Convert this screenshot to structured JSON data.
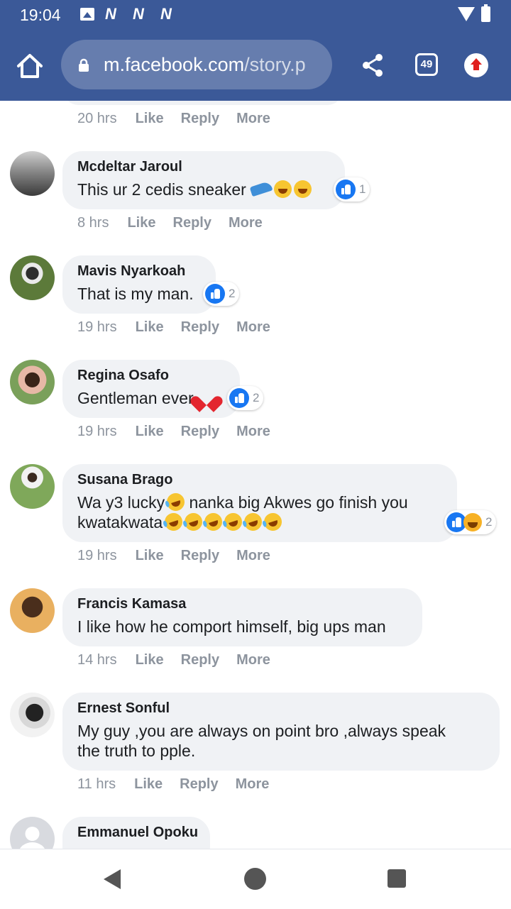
{
  "status_bar": {
    "time": "19:04",
    "notification_icons": [
      "N",
      "N",
      "N"
    ]
  },
  "browser": {
    "url_host": "m.facebook.com",
    "url_path": "/story.p",
    "tab_count": "49"
  },
  "actions": {
    "like": "Like",
    "reply": "Reply",
    "more": "More"
  },
  "top_partial": {
    "time": "20 hrs"
  },
  "comments": [
    {
      "author": "Mcdeltar Jaroul",
      "text": "This ur 2 cedis sneaker",
      "time": "8 hrs",
      "reactions": "1"
    },
    {
      "author": "Mavis Nyarkoah",
      "text": "That is my man.",
      "time": "19 hrs",
      "reactions": "2"
    },
    {
      "author": "Regina Osafo",
      "text": "Gentleman ever",
      "time": "19 hrs",
      "reactions": "2"
    },
    {
      "author": "Susana Brago",
      "text_line1": "Wa y3 lucky",
      "text_line1b": " nanka big Akwes go finish you",
      "text_line2": "kwatakwata",
      "time": "19 hrs",
      "reactions": "2"
    },
    {
      "author": "Francis Kamasa",
      "text": "I like how he comport himself, big ups man",
      "time": "14 hrs"
    },
    {
      "author": "Ernest Sonful",
      "text_line1": "My guy ,you are always on point bro ,always speak",
      "text_line2": "the truth to pple.",
      "time": "11 hrs"
    },
    {
      "author": "Emmanuel Opoku"
    }
  ],
  "colors": {
    "brand": "#3b5998",
    "bubble": "#f0f2f5",
    "muted": "#8d949e",
    "like_blue": "#1877f2"
  }
}
